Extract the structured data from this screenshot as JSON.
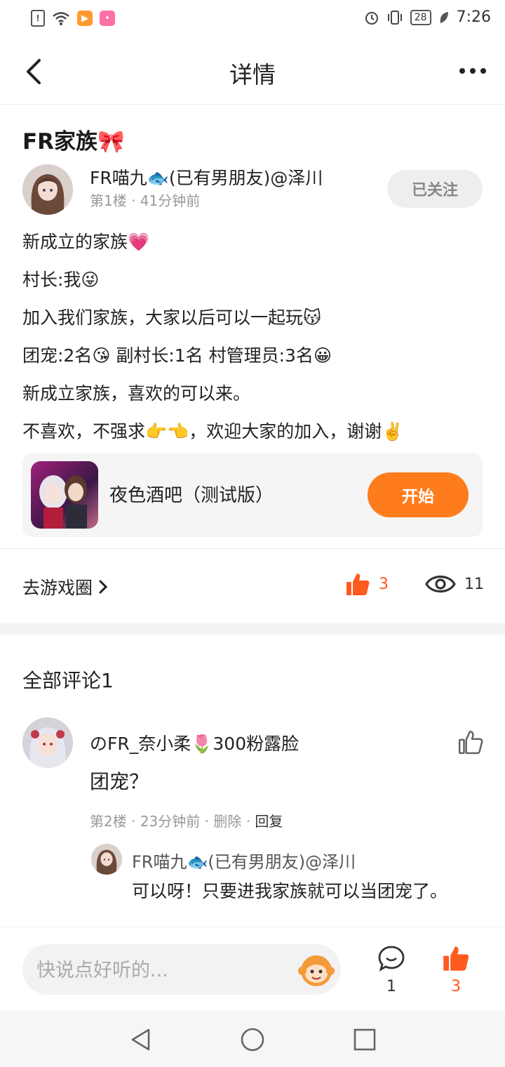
{
  "status_bar": {
    "time": "7:26",
    "battery": "28",
    "left_icons": [
      "sim-alert-icon",
      "wifi-icon",
      "video-app-icon",
      "pink-app-icon"
    ],
    "right_icons": [
      "alarm-icon",
      "vibrate-icon",
      "battery-icon",
      "leaf-icon"
    ]
  },
  "header": {
    "title": "详情",
    "back_icon": "back-chevron-icon",
    "more_icon": "more-dots-icon"
  },
  "post": {
    "title": "FR家族🎀",
    "author": {
      "name": "FR喵九🐟(已有男朋友)@泽川",
      "meta": "第1楼 · 41分钟前",
      "follow_label": "已关注"
    },
    "lines": [
      "新成立的家族💗",
      "村长:我😜",
      "加入我们家族，大家以后可以一起玩😽",
      "团宠:2名😘   副村长:1名   村管理员:3名😀",
      "新成立家族，喜欢的可以来。",
      "不喜欢，不强求👉👈，欢迎大家的加入，谢谢✌️"
    ],
    "game_card": {
      "name": "夜色酒吧（测试版）",
      "start_label": "开始"
    },
    "circle_link": "去游戏圈",
    "likes": "3",
    "views": "11"
  },
  "comments": {
    "title": "全部评论1",
    "items": [
      {
        "name": "のFR_奈小柔🌷300粉露脸",
        "text": "团宠？",
        "floor": "第2楼",
        "time": "23分钟前",
        "delete_label": "删除",
        "reply_label": "回复",
        "reply": {
          "name": "FR喵九🐟(已有男朋友)@泽川",
          "text": "可以呀！只要进我家族就可以当团宠了。"
        }
      }
    ]
  },
  "bottom_bar": {
    "placeholder": "快说点好听的...",
    "comment_count": "1",
    "like_count": "3"
  },
  "colors": {
    "accent": "#ff7c1c",
    "like": "#ff5a1f",
    "muted": "#999999"
  }
}
